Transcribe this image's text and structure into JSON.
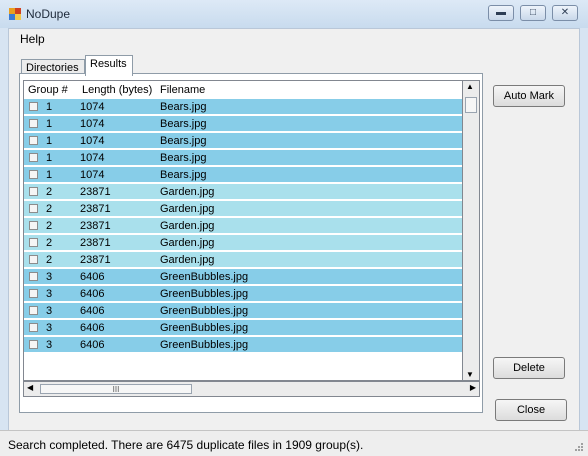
{
  "window": {
    "title": "NoDupe"
  },
  "menu": {
    "help": "Help"
  },
  "tabs": [
    {
      "label": "Directories"
    },
    {
      "label": "Results"
    }
  ],
  "grid": {
    "headers": [
      "Group #",
      "Length (bytes)",
      "Filename"
    ],
    "rows": [
      {
        "group": "1",
        "length": "1074",
        "filename": "Bears.jpg"
      },
      {
        "group": "1",
        "length": "1074",
        "filename": "Bears.jpg"
      },
      {
        "group": "1",
        "length": "1074",
        "filename": "Bears.jpg"
      },
      {
        "group": "1",
        "length": "1074",
        "filename": "Bears.jpg"
      },
      {
        "group": "1",
        "length": "1074",
        "filename": "Bears.jpg"
      },
      {
        "group": "2",
        "length": "23871",
        "filename": "Garden.jpg"
      },
      {
        "group": "2",
        "length": "23871",
        "filename": "Garden.jpg"
      },
      {
        "group": "2",
        "length": "23871",
        "filename": "Garden.jpg"
      },
      {
        "group": "2",
        "length": "23871",
        "filename": "Garden.jpg"
      },
      {
        "group": "2",
        "length": "23871",
        "filename": "Garden.jpg"
      },
      {
        "group": "3",
        "length": "6406",
        "filename": "GreenBubbles.jpg"
      },
      {
        "group": "3",
        "length": "6406",
        "filename": "GreenBubbles.jpg"
      },
      {
        "group": "3",
        "length": "6406",
        "filename": "GreenBubbles.jpg"
      },
      {
        "group": "3",
        "length": "6406",
        "filename": "GreenBubbles.jpg"
      },
      {
        "group": "3",
        "length": "6406",
        "filename": "GreenBubbles.jpg"
      }
    ]
  },
  "hscroll": {
    "thumb_grip": "III"
  },
  "buttons": {
    "auto_mark": "Auto Mark",
    "delete": "Delete",
    "close": "Close"
  },
  "status": {
    "text": "Search completed. There are 6475 duplicate files in 1909 group(s)."
  },
  "colors": {
    "group_odd": "#87cde8",
    "group_even": "#a9e0ec"
  },
  "icons": {
    "app": "app-icon",
    "minimize": "minimize-icon",
    "maximize": "maximize-icon",
    "close": "close-icon"
  }
}
